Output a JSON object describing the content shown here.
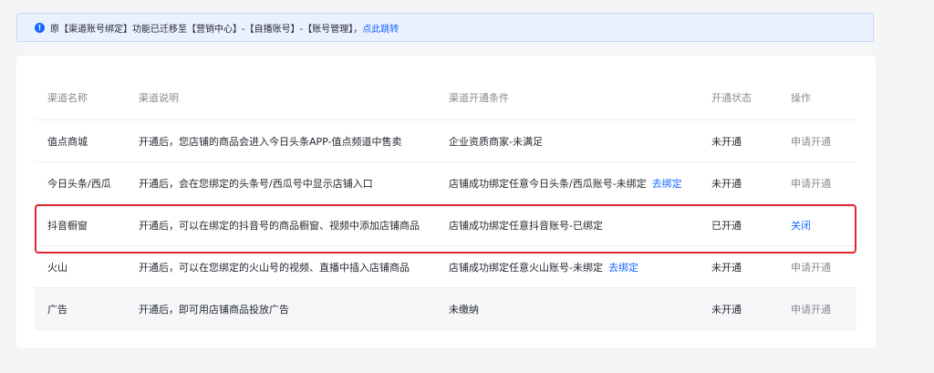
{
  "notice": {
    "icon": "info-icon",
    "text": "原【渠道账号绑定】功能已迁移至【营销中心】-【自播账号】-【账号管理】，",
    "link": "点此跳转",
    "accent": "#1966ff"
  },
  "table": {
    "headers": {
      "name": "渠道名称",
      "desc": "渠道说明",
      "cond": "渠道开通条件",
      "status": "开通状态",
      "action": "操作"
    },
    "rows": [
      {
        "name": "值点商城",
        "desc": "开通后，您店铺的商品会进入今日头条APP-值点频道中售卖",
        "cond": "企业资质商家-未满足",
        "cond_link": "",
        "status": "未开通",
        "action": "申请开通"
      },
      {
        "name": "今日头条/西瓜",
        "desc": "开通后，会在您绑定的头条号/西瓜号中显示店铺入口",
        "cond": "店铺成功绑定任意今日头条/西瓜账号-未绑定",
        "cond_link": "去绑定",
        "status": "未开通",
        "action": "申请开通"
      },
      {
        "name": "抖音橱窗",
        "desc": "开通后，可以在绑定的抖音号的商品橱窗、视频中添加店铺商品",
        "cond": "店铺成功绑定任意抖音账号-已绑定",
        "cond_link": "",
        "status": "已开通",
        "action": "关闭"
      },
      {
        "name": "火山",
        "desc": "开通后，可以在您绑定的火山号的视频、直播中插入店铺商品",
        "cond": "店铺成功绑定任意火山账号-未绑定",
        "cond_link": "去绑定",
        "status": "未开通",
        "action": "申请开通"
      },
      {
        "name": "广告",
        "desc": "开通后，即可用店铺商品投放广告",
        "cond": "未缴纳",
        "cond_link": "",
        "status": "未开通",
        "action": "申请开通"
      }
    ]
  },
  "colors": {
    "link": "#1966ff",
    "muted": "#898b8f",
    "highlight": "#e0262c",
    "notice_bg": "#eaf1fe"
  }
}
